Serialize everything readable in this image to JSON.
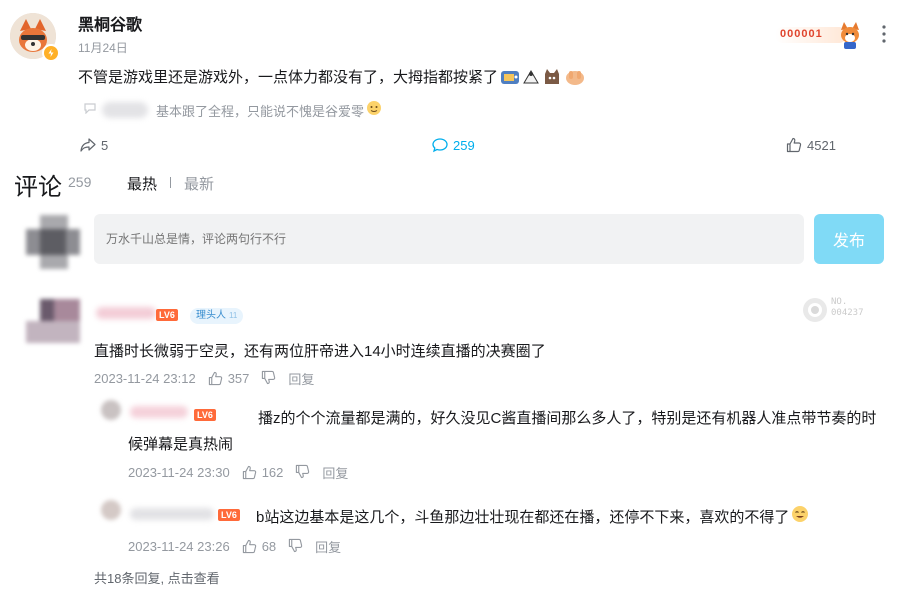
{
  "post": {
    "author": "黑桐谷歌",
    "date": "11月24日",
    "content": "不管是游戏里还是游戏外，一点体力都没有了，大拇指都按紧了",
    "fan_badge_number": "000001",
    "quoted_comment": "基本跟了全程，只能说不愧是谷爱零",
    "stats": {
      "forward": "5",
      "comment": "259",
      "like": "4521"
    }
  },
  "comments_header": {
    "title": "评论",
    "count": "259",
    "sort_hot": "最热",
    "sort_new": "最新"
  },
  "composer": {
    "placeholder": "万水千山总是情，评论两句行不行",
    "submit_label": "发布"
  },
  "comments": [
    {
      "level": "LV6",
      "tag": "理头人",
      "tag_level": "11",
      "badge_number": "NO.\n004237",
      "text": "直播时长微弱于空灵，还有两位肝帝进入14小时连续直播的决赛圈了",
      "time": "2023-11-24 23:12",
      "likes": "357",
      "reply_label": "回复",
      "replies": [
        {
          "level": "LV6",
          "text": "播z的个个流量都是满的，好久没见C酱直播间那么多人了，特别是还有机器人准点带节奏的时候弹幕是真热闹",
          "time": "2023-11-24 23:30",
          "likes": "162",
          "reply_label": "回复"
        },
        {
          "level": "LV6",
          "text": "b站这边基本是这几个，斗鱼那边壮壮现在都还在播，还停不下来，喜欢的不得了",
          "time": "2023-11-24 23:26",
          "likes": "68",
          "reply_label": "回复"
        }
      ],
      "more_replies": "共18条回复, 点击查看"
    }
  ],
  "colors": {
    "accent_blue": "#00aeec",
    "submit_bg": "#80daf6",
    "input_bg": "#f1f2f3",
    "level_orange": "#ff6a3a",
    "muted_text": "#9499a0"
  }
}
